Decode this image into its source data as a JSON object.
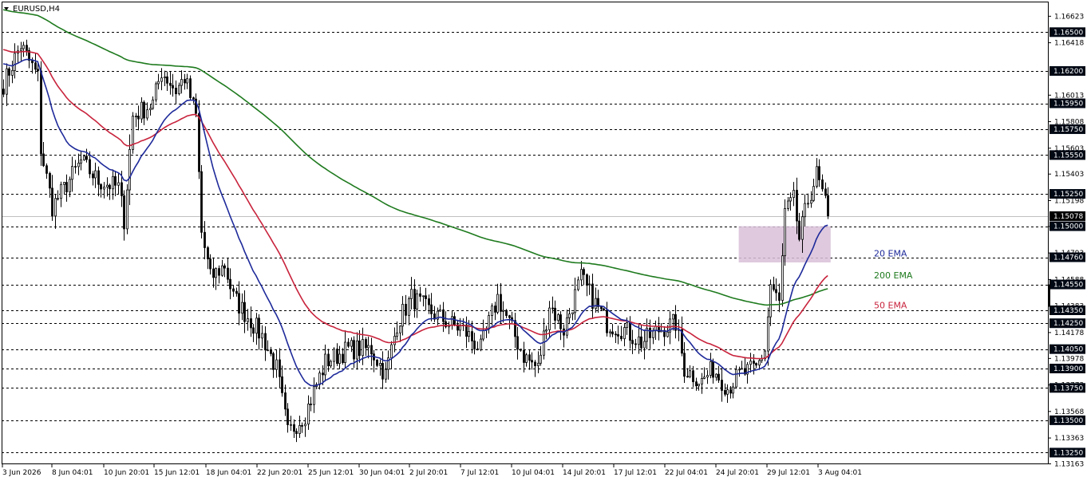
{
  "chart_data": {
    "type": "candlestick",
    "title": "EURUSD,H4",
    "ylim": [
      1.1316,
      1.1673
    ],
    "grid": false,
    "price_ticks": [
      "1.16623",
      "1.16418",
      "1.16013",
      "1.15808",
      "1.15603",
      "1.15403",
      "1.15198",
      "1.14998",
      "1.14793",
      "1.14588",
      "1.14383",
      "1.14178",
      "1.13978",
      "1.13773",
      "1.13568",
      "1.13363",
      "1.13163"
    ],
    "horizontal_levels": [
      1.165,
      1.162,
      1.1595,
      1.1575,
      1.1555,
      1.1525,
      1.15,
      1.1476,
      1.1455,
      1.1435,
      1.1425,
      1.1405,
      1.139,
      1.1375,
      1.135,
      1.1325
    ],
    "level_labels": [
      "1.16500",
      "1.16200",
      "1.15950",
      "1.15750",
      "1.15550",
      "1.15250",
      "1.15000",
      "1.14760",
      "1.14550",
      "1.14350",
      "1.14250",
      "1.14050",
      "1.13900",
      "1.13750",
      "1.13500",
      "1.13250"
    ],
    "current_price": {
      "value": 1.15078,
      "label": "1.15078"
    },
    "time_labels": [
      "3 Jun 2026",
      "8 Jun 04:01",
      "10 Jun 20:01",
      "15 Jun 12:01",
      "18 Jun 04:01",
      "22 Jun 20:01",
      "25 Jun 12:01",
      "30 Jun 04:01",
      "2 Jul 20:01",
      "7 Jul 12:01",
      "10 Jul 04:01",
      "14 Jul 20:01",
      "17 Jul 12:01",
      "22 Jul 04:01",
      "24 Jul 20:01",
      "29 Jul 12:01",
      "3 Aug 04:01"
    ],
    "zone": {
      "price_high": 1.15,
      "price_low": 1.1472,
      "start_bar": 256,
      "end_bar": 288,
      "color": "#d8bfd8"
    },
    "ema_labels": [
      {
        "text": "20 EMA",
        "color": "#1e2a9a",
        "price": 1.1479
      },
      {
        "text": "200 EMA",
        "color": "#1e7a1e",
        "price": 1.1462
      },
      {
        "text": "50 EMA",
        "color": "#c8233c",
        "price": 1.1439
      }
    ],
    "anchors": [
      [
        0,
        1.161
      ],
      [
        6,
        1.164
      ],
      [
        12,
        1.1615
      ],
      [
        13,
        1.156
      ],
      [
        17,
        1.1515
      ],
      [
        27,
        1.155
      ],
      [
        33,
        1.1535
      ],
      [
        40,
        1.153
      ],
      [
        42,
        1.1505
      ],
      [
        45,
        1.1585
      ],
      [
        52,
        1.1595
      ],
      [
        55,
        1.162
      ],
      [
        60,
        1.1605
      ],
      [
        63,
        1.1615
      ],
      [
        67,
        1.1585
      ],
      [
        69,
        1.1495
      ],
      [
        72,
        1.146
      ],
      [
        77,
        1.147
      ],
      [
        80,
        1.1445
      ],
      [
        90,
        1.1415
      ],
      [
        95,
        1.139
      ],
      [
        99,
        1.134
      ],
      [
        105,
        1.1355
      ],
      [
        112,
        1.1395
      ],
      [
        120,
        1.1405
      ],
      [
        128,
        1.1405
      ],
      [
        133,
        1.1385
      ],
      [
        137,
        1.1425
      ],
      [
        142,
        1.1445
      ],
      [
        148,
        1.1435
      ],
      [
        155,
        1.1425
      ],
      [
        160,
        1.142
      ],
      [
        166,
        1.1405
      ],
      [
        172,
        1.1445
      ],
      [
        178,
        1.1415
      ],
      [
        181,
        1.14
      ],
      [
        186,
        1.139
      ],
      [
        190,
        1.144
      ],
      [
        195,
        1.142
      ],
      [
        201,
        1.146
      ],
      [
        206,
        1.144
      ],
      [
        210,
        1.1425
      ],
      [
        216,
        1.142
      ],
      [
        222,
        1.141
      ],
      [
        228,
        1.142
      ],
      [
        234,
        1.1425
      ],
      [
        237,
        1.139
      ],
      [
        243,
        1.138
      ],
      [
        247,
        1.139
      ],
      [
        252,
        1.1375
      ],
      [
        256,
        1.1385
      ],
      [
        262,
        1.139
      ],
      [
        265,
        1.1405
      ],
      [
        267,
        1.1455
      ],
      [
        270,
        1.144
      ],
      [
        272,
        1.151
      ],
      [
        275,
        1.152
      ],
      [
        277,
        1.149
      ],
      [
        280,
        1.152
      ],
      [
        283,
        1.154
      ],
      [
        285,
        1.1525
      ],
      [
        287,
        1.1508
      ]
    ],
    "seed": 7
  }
}
